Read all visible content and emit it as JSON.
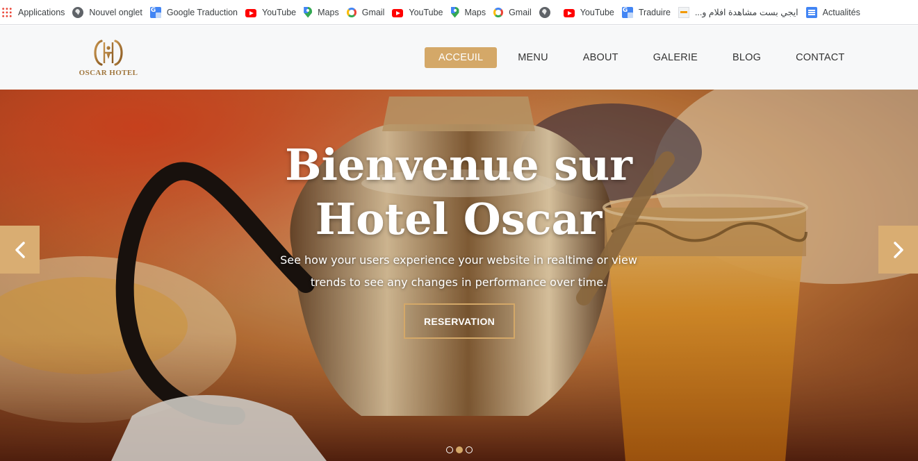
{
  "bookmarks": [
    {
      "label": "Applications",
      "icon": "apps-icon"
    },
    {
      "label": "Nouvel onglet",
      "icon": "globe-icon"
    },
    {
      "label": "Google Traduction",
      "icon": "google-translate-icon"
    },
    {
      "label": "YouTube",
      "icon": "youtube-icon"
    },
    {
      "label": "Maps",
      "icon": "maps-icon"
    },
    {
      "label": "Gmail",
      "icon": "google-icon"
    },
    {
      "label": "YouTube",
      "icon": "youtube-icon"
    },
    {
      "label": "Maps",
      "icon": "maps-icon"
    },
    {
      "label": "Gmail",
      "icon": "google-icon"
    },
    {
      "label": "",
      "icon": "globe-icon"
    },
    {
      "label": "YouTube",
      "icon": "youtube-icon"
    },
    {
      "label": "Traduire",
      "icon": "google-translate-icon"
    },
    {
      "label": "ايجي بست مشاهدة افلام و...",
      "icon": "site-icon"
    },
    {
      "label": "Actualités",
      "icon": "news-icon"
    }
  ],
  "header": {
    "logo_text": "OSCAR HOTEL",
    "nav": [
      {
        "label": "ACCEUIL",
        "active": true
      },
      {
        "label": "MENU",
        "active": false
      },
      {
        "label": "ABOUT",
        "active": false
      },
      {
        "label": "GALERIE",
        "active": false
      },
      {
        "label": "BLOG",
        "active": false
      },
      {
        "label": "CONTACT",
        "active": false
      }
    ]
  },
  "hero": {
    "title": "Bienvenue sur Hotel Oscar",
    "subtitle": "See how your users experience your website in realtime or view trends to see any changes in performance over time.",
    "button_label": "RESERVATION",
    "slides": 3,
    "active_slide": 2
  },
  "colors": {
    "accent": "#d4a868",
    "arrow_bg": "#d9ad72",
    "logo_gold": "#a0763d"
  }
}
